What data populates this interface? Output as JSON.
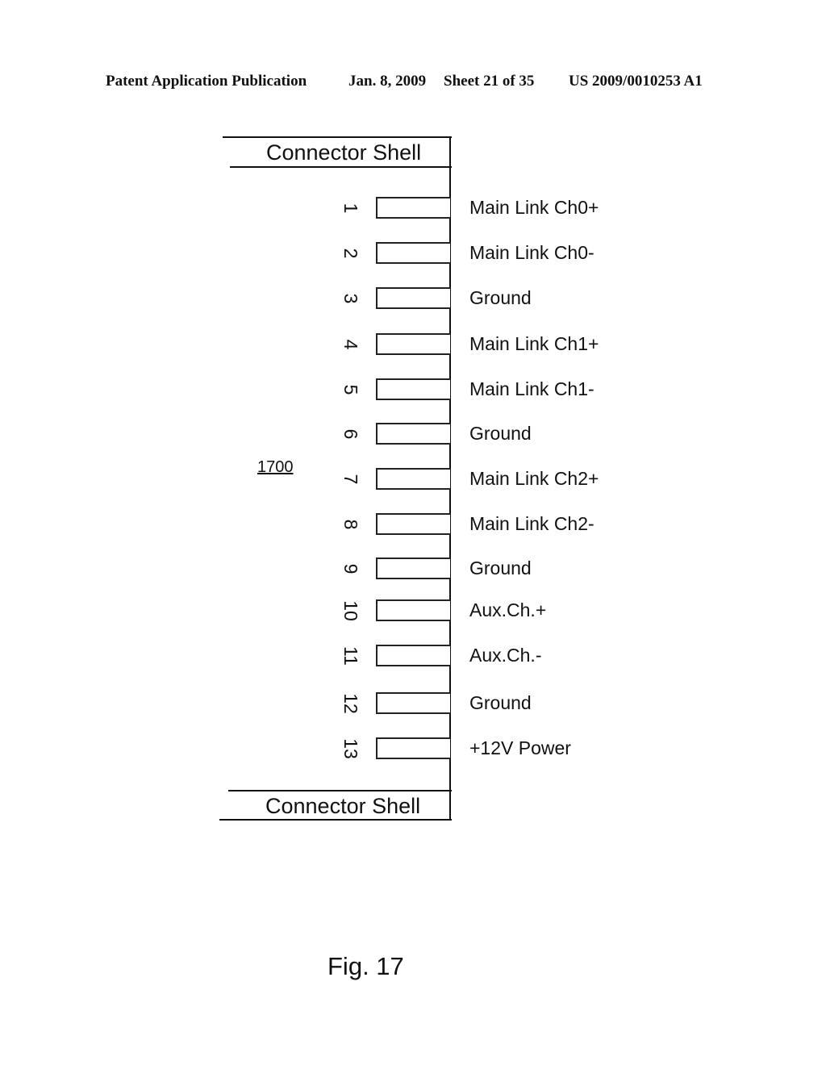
{
  "header": {
    "publication": "Patent Application Publication",
    "date": "Jan. 8, 2009",
    "sheet": "Sheet 21 of 35",
    "number": "US 2009/0010253 A1"
  },
  "diagram": {
    "reference": "1700",
    "top_shell": "Connector Shell",
    "bottom_shell": "Connector Shell",
    "pins": [
      {
        "number": "1",
        "label": "Main Link Ch0+"
      },
      {
        "number": "2",
        "label": "Main Link Ch0-"
      },
      {
        "number": "3",
        "label": "Ground"
      },
      {
        "number": "4",
        "label": "Main Link Ch1+"
      },
      {
        "number": "5",
        "label": "Main Link Ch1-"
      },
      {
        "number": "6",
        "label": "Ground"
      },
      {
        "number": "7",
        "label": "Main Link Ch2+"
      },
      {
        "number": "8",
        "label": "Main Link Ch2-"
      },
      {
        "number": "9",
        "label": "Ground"
      },
      {
        "number": "10",
        "label": "Aux.Ch.+"
      },
      {
        "number": "11",
        "label": "Aux.Ch.-"
      },
      {
        "number": "12",
        "label": "Ground"
      },
      {
        "number": "13",
        "label": "+12V Power"
      }
    ]
  },
  "caption": "Fig. 17"
}
